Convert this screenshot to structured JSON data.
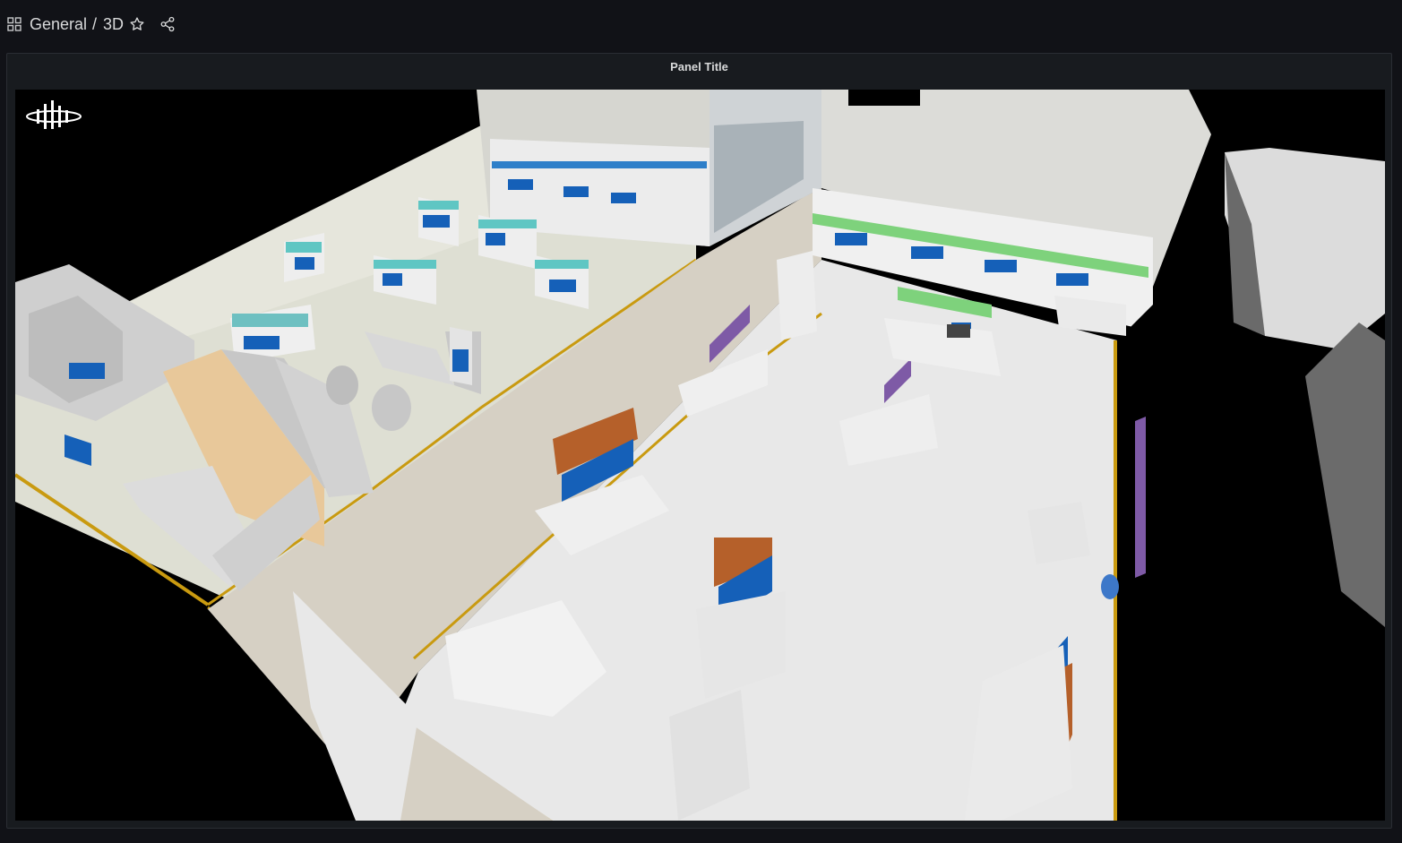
{
  "header": {
    "folder": "General",
    "separator": "/",
    "dashboard_title": "3D",
    "icons": [
      "dashboard-grid-icon",
      "star-icon",
      "share-icon"
    ]
  },
  "panel": {
    "title": "Panel Title"
  },
  "scene": {
    "description_icon": "logo-icon",
    "background": "#000000",
    "floor_color": "#e4e4e4",
    "aisle_color": "#d8d3c8",
    "accent_colors": {
      "blue": "#1560b8",
      "teal": "#5fc6c3",
      "green": "#7ed27c",
      "orange": "#b5602a",
      "purple": "#7e5aa6",
      "edge": "#c99a10"
    }
  }
}
